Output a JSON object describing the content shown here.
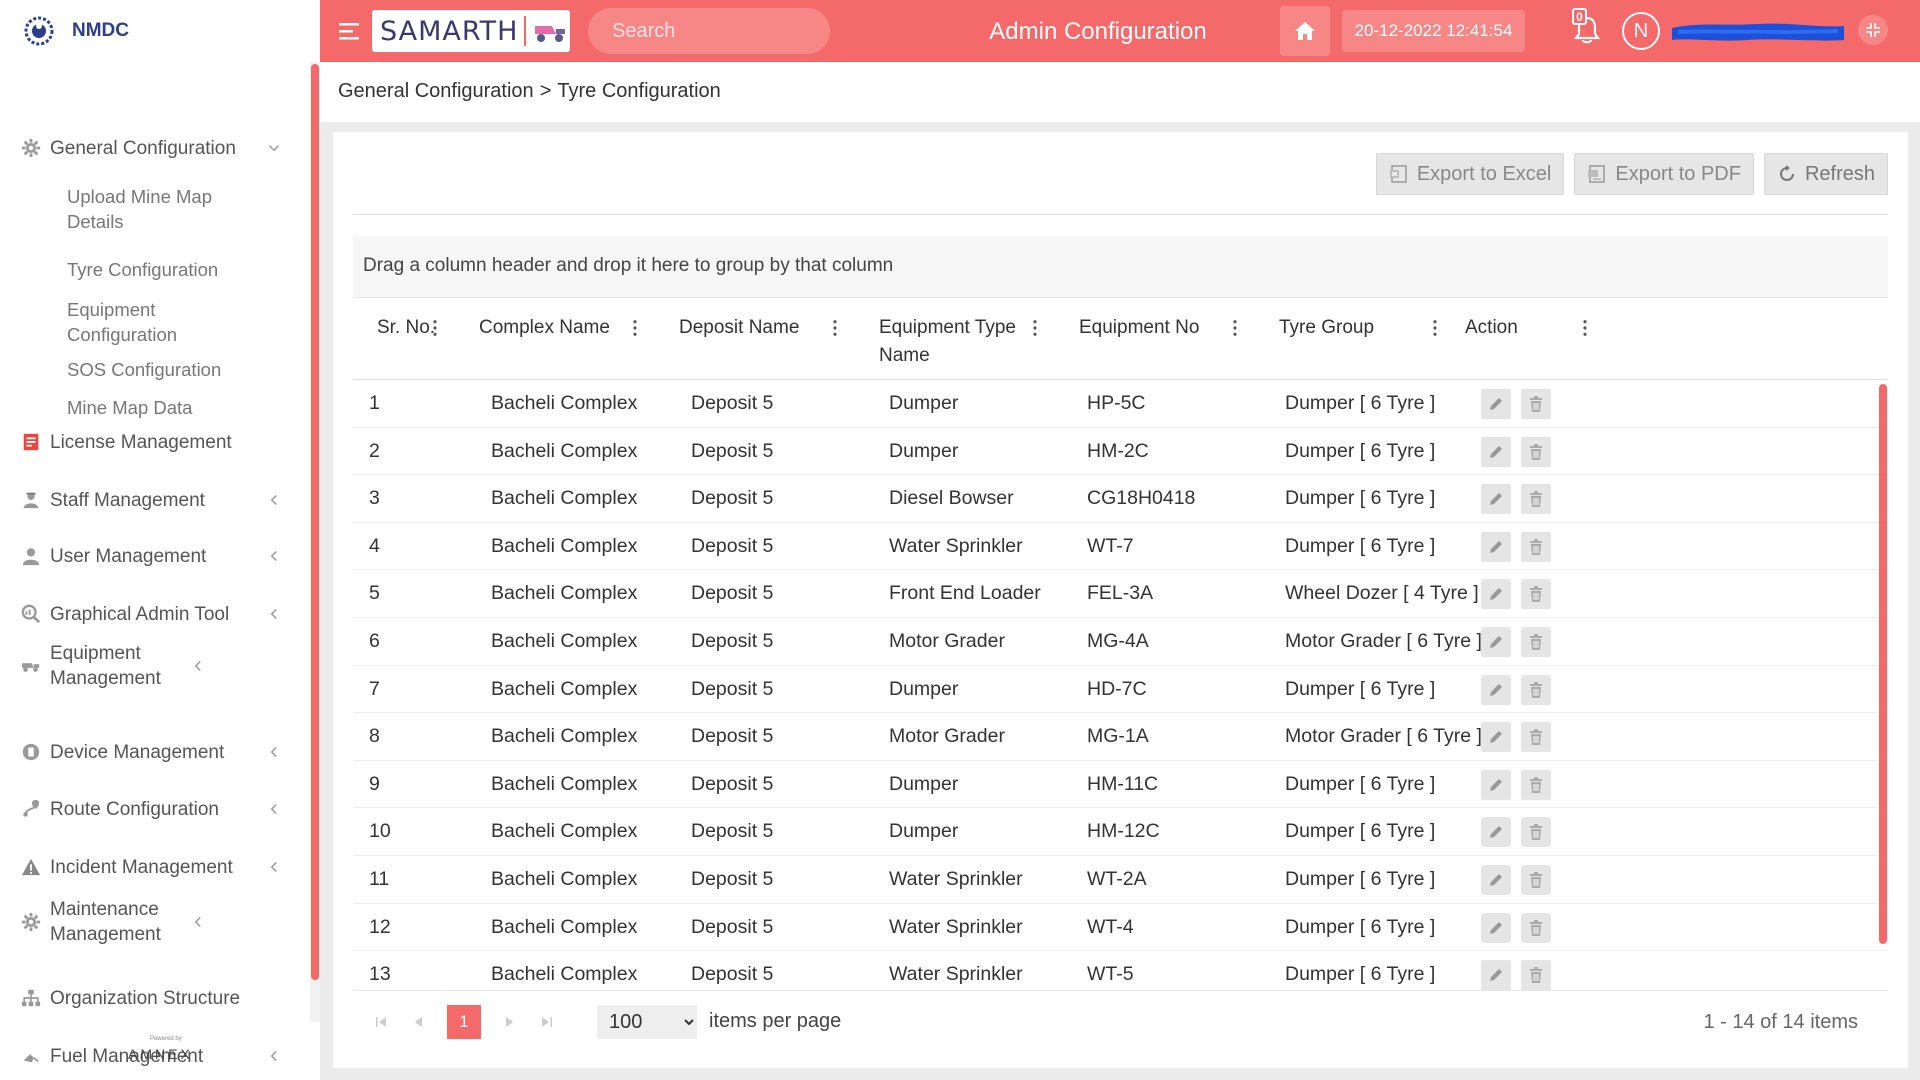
{
  "brand": {
    "name": "NMDC"
  },
  "sidebar": {
    "items": [
      {
        "label": "General Configuration",
        "icon": "gear-icon",
        "open": true,
        "children": [
          "Upload Mine Map Details",
          "Tyre Configuration",
          "Equipment Configuration",
          "SOS Configuration",
          "Mine Map Data"
        ]
      },
      {
        "label": "License Management",
        "icon": "license-icon"
      },
      {
        "label": "Staff Management",
        "icon": "staff-icon",
        "caret": true
      },
      {
        "label": "User Management",
        "icon": "user-icon",
        "caret": true
      },
      {
        "label": "Graphical Admin Tool",
        "icon": "chart-search-icon",
        "caret": true
      },
      {
        "label": "Equipment Management",
        "icon": "truck-icon",
        "caret": true
      },
      {
        "label": "Device Management",
        "icon": "device-icon",
        "caret": true
      },
      {
        "label": "Route Configuration",
        "icon": "route-icon",
        "caret": true
      },
      {
        "label": "Incident Management",
        "icon": "warning-icon",
        "caret": true
      },
      {
        "label": "Maintenance Management",
        "icon": "cog-icon",
        "caret": true
      },
      {
        "label": "Organization Structure",
        "icon": "org-icon"
      },
      {
        "label": "Fuel Management",
        "icon": "fuel-icon",
        "caret": true
      }
    ],
    "footer_brand": "AMNEX",
    "footer_powered": "Powered by"
  },
  "header": {
    "logo_text": "SAMARTH",
    "search_placeholder": "Search",
    "title": "Admin Configuration",
    "datetime": "20-12-2022 12:41:54",
    "notification_count": "0",
    "avatar_initial": "N",
    "user_name_hint": "......"
  },
  "breadcrumb": {
    "parent": "General Configuration",
    "separator": ">",
    "current": "Tyre Configuration"
  },
  "toolbar": {
    "excel": "Export to Excel",
    "pdf": "Export to PDF",
    "refresh": "Refresh"
  },
  "grid": {
    "group_hint": "Drag a column header and drop it here to group by that column",
    "columns": [
      "Sr. No.",
      "Complex Name",
      "Deposit Name",
      "Equipment Type Name",
      "Equipment No",
      "Tyre Group",
      "Action"
    ],
    "rows": [
      [
        "1",
        "Bacheli Complex",
        "Deposit 5",
        "Dumper",
        "HP-5C",
        "Dumper [ 6 Tyre ]"
      ],
      [
        "2",
        "Bacheli Complex",
        "Deposit 5",
        "Dumper",
        "HM-2C",
        "Dumper [ 6 Tyre ]"
      ],
      [
        "3",
        "Bacheli Complex",
        "Deposit 5",
        "Diesel Bowser",
        "CG18H0418",
        "Dumper [ 6 Tyre ]"
      ],
      [
        "4",
        "Bacheli Complex",
        "Deposit 5",
        "Water Sprinkler",
        "WT-7",
        "Dumper [ 6 Tyre ]"
      ],
      [
        "5",
        "Bacheli Complex",
        "Deposit 5",
        "Front End Loader",
        "FEL-3A",
        "Wheel Dozer [ 4 Tyre ]"
      ],
      [
        "6",
        "Bacheli Complex",
        "Deposit 5",
        "Motor Grader",
        "MG-4A",
        "Motor Grader [ 6 Tyre ]"
      ],
      [
        "7",
        "Bacheli Complex",
        "Deposit 5",
        "Dumper",
        "HD-7C",
        "Dumper [ 6 Tyre ]"
      ],
      [
        "8",
        "Bacheli Complex",
        "Deposit 5",
        "Motor Grader",
        "MG-1A",
        "Motor Grader [ 6 Tyre ]"
      ],
      [
        "9",
        "Bacheli Complex",
        "Deposit 5",
        "Dumper",
        "HM-11C",
        "Dumper [ 6 Tyre ]"
      ],
      [
        "10",
        "Bacheli Complex",
        "Deposit 5",
        "Dumper",
        "HM-12C",
        "Dumper [ 6 Tyre ]"
      ],
      [
        "11",
        "Bacheli Complex",
        "Deposit 5",
        "Water Sprinkler",
        "WT-2A",
        "Dumper [ 6 Tyre ]"
      ],
      [
        "12",
        "Bacheli Complex",
        "Deposit 5",
        "Water Sprinkler",
        "WT-4",
        "Dumper [ 6 Tyre ]"
      ],
      [
        "13",
        "Bacheli Complex",
        "Deposit 5",
        "Water Sprinkler",
        "WT-5",
        "Dumper [ 6 Tyre ]"
      ]
    ]
  },
  "pager": {
    "current_page": "1",
    "page_size": "100",
    "page_size_options": [
      "100"
    ],
    "items_per_page_label": "items per page",
    "info": "1 - 14 of 14 items"
  },
  "colors": {
    "accent": "#f46a6a",
    "brand": "#2d3e8c"
  }
}
